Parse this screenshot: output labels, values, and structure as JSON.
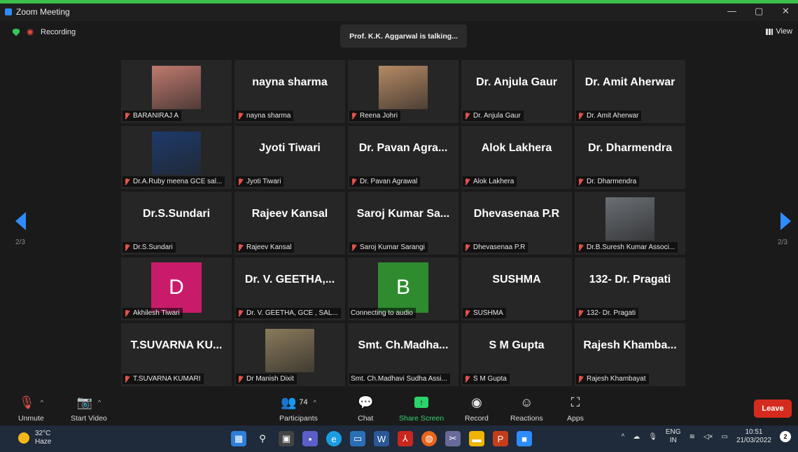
{
  "window": {
    "title": "Zoom Meeting",
    "min": "—",
    "restore": "▢",
    "close": "✕"
  },
  "top": {
    "recording": "Recording",
    "talking": "Prof. K.K. Aggarwal is talking...",
    "view": "View"
  },
  "pager": {
    "left": "2/3",
    "right": "2/3"
  },
  "tiles": [
    {
      "name": "BARANIRAJ A",
      "big": "",
      "kind": "photo",
      "bg": "#c07a6e"
    },
    {
      "name": "nayna sharma",
      "big": "nayna sharma",
      "kind": "text"
    },
    {
      "name": "Reena Johri",
      "big": "",
      "kind": "photo",
      "bg": "#b68a64"
    },
    {
      "name": "Dr. Anjula Gaur",
      "big": "Dr. Anjula Gaur",
      "kind": "text"
    },
    {
      "name": "Dr. Amit Aherwar",
      "big": "Dr. Amit Aherwar",
      "kind": "text"
    },
    {
      "name": "Dr.A.Ruby meena GCE sal...",
      "big": "",
      "kind": "photo",
      "bg": "#1d3a6b"
    },
    {
      "name": "Jyoti Tiwari",
      "big": "Jyoti Tiwari",
      "kind": "text"
    },
    {
      "name": "Dr. Pavan Agrawal",
      "big": "Dr. Pavan Agra...",
      "kind": "text"
    },
    {
      "name": "Alok Lakhera",
      "big": "Alok Lakhera",
      "kind": "text"
    },
    {
      "name": "Dr. Dharmendra",
      "big": "Dr. Dharmendra",
      "kind": "text"
    },
    {
      "name": "Dr.S.Sundari",
      "big": "Dr.S.Sundari",
      "kind": "text"
    },
    {
      "name": "Rajeev Kansal",
      "big": "Rajeev Kansal",
      "kind": "text"
    },
    {
      "name": "Saroj Kumar Sarangi",
      "big": "Saroj Kumar Sa...",
      "kind": "text"
    },
    {
      "name": "Dhevasenaa P.R",
      "big": "Dhevasenaa P.R",
      "kind": "text"
    },
    {
      "name": "Dr.B.Suresh Kumar Associ...",
      "big": "",
      "kind": "photo",
      "bg": "#6a6f75"
    },
    {
      "name": "Akhilesh Tiwari",
      "big": "D",
      "kind": "avatar",
      "bg": "#c81c6a"
    },
    {
      "name": "Dr. V. GEETHA, GCE , SAL...",
      "big": "Dr. V. GEETHA,...",
      "kind": "text"
    },
    {
      "name": "Connecting to audio",
      "big": "B",
      "kind": "avatar",
      "bg": "#2e8b2e",
      "nomute": true
    },
    {
      "name": "SUSHMA",
      "big": "SUSHMA",
      "kind": "text"
    },
    {
      "name": "132- Dr. Pragati",
      "big": "132- Dr. Pragati",
      "kind": "text"
    },
    {
      "name": "T.SUVARNA KUMARI",
      "big": "T.SUVARNA KU...",
      "kind": "text"
    },
    {
      "name": "Dr Manish Dixit",
      "big": "",
      "kind": "photo",
      "bg": "#8a7a5a"
    },
    {
      "name": "Smt. Ch.Madhavi Sudha Assi...",
      "big": "Smt. Ch.Madha...",
      "kind": "text",
      "nomute": true
    },
    {
      "name": "S M Gupta",
      "big": "S M Gupta",
      "kind": "text"
    },
    {
      "name": "Rajesh Khambayat",
      "big": "Rajesh Khamba...",
      "kind": "text"
    }
  ],
  "toolbar": {
    "unmute": "Unmute",
    "start_video": "Start Video",
    "participants": "Participants",
    "participant_count": "74",
    "chat": "Chat",
    "share": "Share Screen",
    "record": "Record",
    "reactions": "Reactions",
    "apps": "Apps",
    "leave": "Leave"
  },
  "taskbar": {
    "temp": "32°C",
    "weather": "Haze",
    "lang1": "ENG",
    "lang2": "IN",
    "time": "10:51",
    "date": "21/03/2022",
    "notif": "2"
  },
  "colors": {
    "accent": "#2d8cff",
    "leave": "#d52b1e",
    "share": "#2bd36b",
    "titlebar_stripe": "#3bbf4a"
  }
}
